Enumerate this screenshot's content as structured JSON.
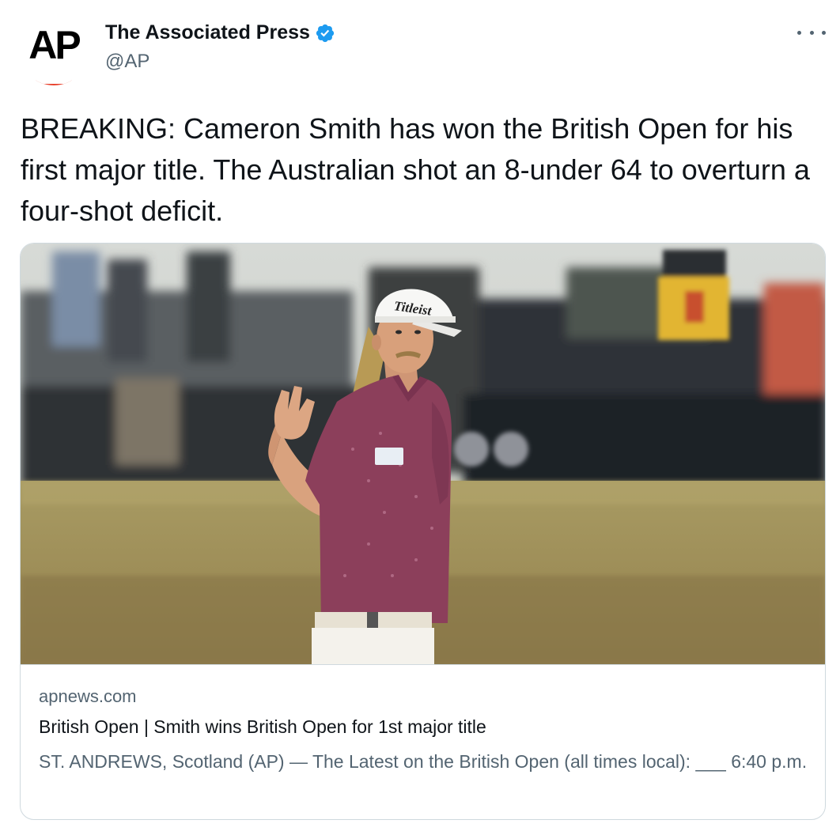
{
  "author": {
    "display_name": "The Associated Press",
    "handle": "@AP",
    "avatar_text": "AP",
    "verified": true
  },
  "tweet": {
    "text": "BREAKING: Cameron Smith has won the British Open for his first major title. The Australian shot an 8-under 64 to overturn a four-shot deficit."
  },
  "card": {
    "image_description": "Golfer in maroon polo and white Titleist cap holding up three fingers",
    "cap_logo": "Titleist",
    "domain": "apnews.com",
    "title": "British Open | Smith wins British Open for 1st major title",
    "description": "ST. ANDREWS, Scotland (AP) — The Latest on the British Open (all times local): ___ 6:40 p.m."
  },
  "colors": {
    "accent": "#1d9bf0",
    "ap_red": "#e8432f",
    "text_primary": "#0f1419",
    "text_secondary": "#536471",
    "border": "#cfd9de"
  }
}
